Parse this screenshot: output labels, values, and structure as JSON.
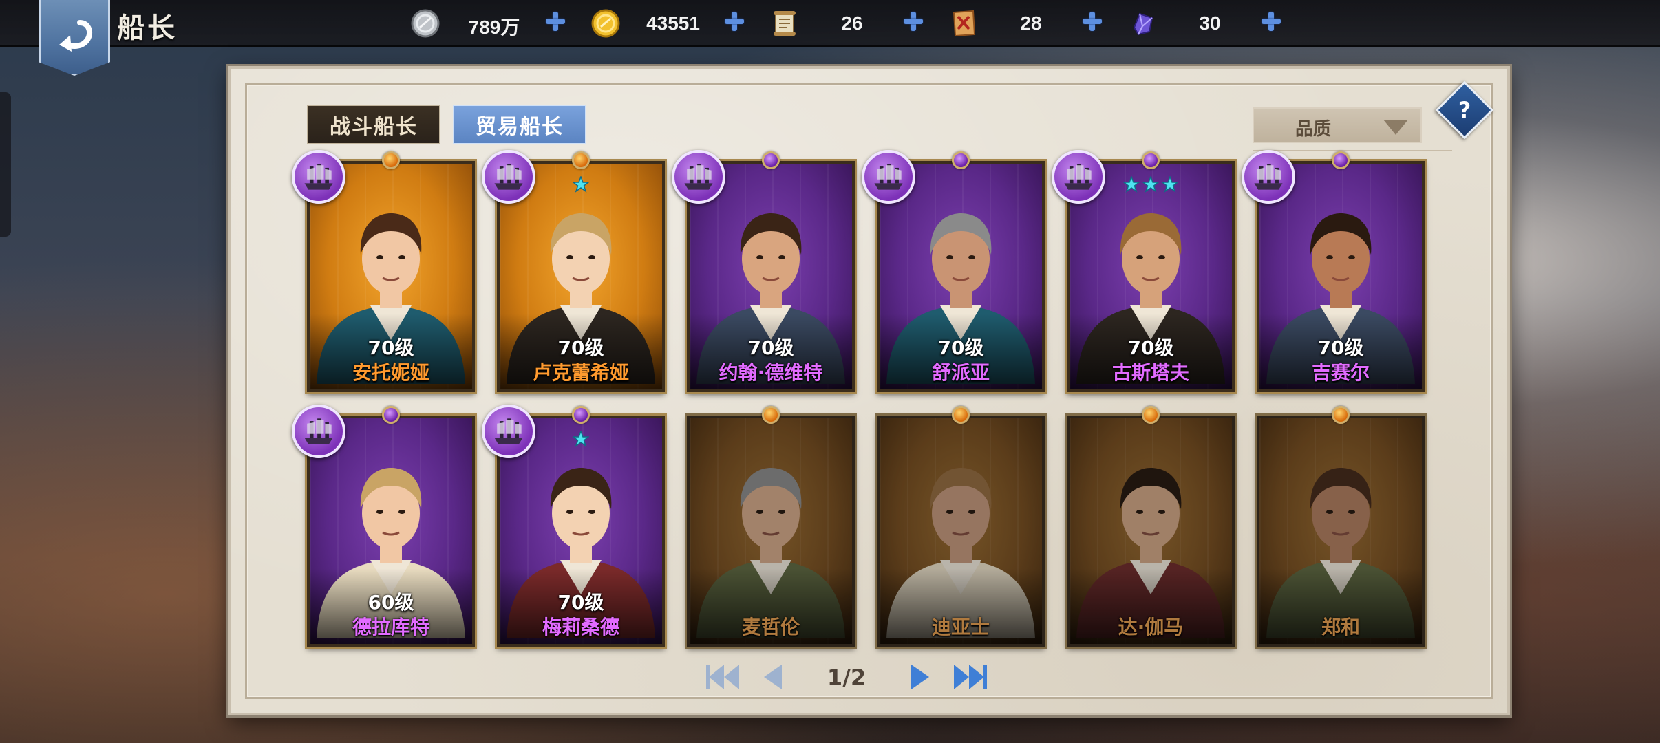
{
  "header": {
    "title": "船长",
    "back_icon": "back-arrow-icon",
    "currencies": [
      {
        "id": "silver",
        "icon": "silver-coin-icon",
        "value": "789万"
      },
      {
        "id": "gold",
        "icon": "gold-coin-icon",
        "value": "43551"
      },
      {
        "id": "scroll",
        "icon": "scroll-icon",
        "value": "26"
      },
      {
        "id": "map",
        "icon": "treasure-map-icon",
        "value": "28"
      },
      {
        "id": "crystal",
        "icon": "crystal-icon",
        "value": "30"
      }
    ]
  },
  "tabs": {
    "battle": "战斗船长",
    "trade": "贸易船长",
    "active": "trade"
  },
  "filter": {
    "label": "品质"
  },
  "help": {
    "label": "?"
  },
  "captains": [
    {
      "name": "安托妮娅",
      "level": "70级",
      "rarity": "orange",
      "owned": true,
      "stars": 0
    },
    {
      "name": "卢克蕾希娅",
      "level": "70级",
      "rarity": "orange",
      "owned": true,
      "stars": 1
    },
    {
      "name": "约翰·德维特",
      "level": "70级",
      "rarity": "purple",
      "owned": true,
      "stars": 0
    },
    {
      "name": "舒派亚",
      "level": "70级",
      "rarity": "purple",
      "owned": true,
      "stars": 0
    },
    {
      "name": "古斯塔夫",
      "level": "70级",
      "rarity": "purple",
      "owned": true,
      "stars": 3
    },
    {
      "name": "吉赛尔",
      "level": "70级",
      "rarity": "purple",
      "owned": true,
      "stars": 0
    },
    {
      "name": "德拉库特",
      "level": "60级",
      "rarity": "purple",
      "owned": true,
      "stars": 0
    },
    {
      "name": "梅莉桑德",
      "level": "70级",
      "rarity": "purple",
      "owned": true,
      "stars": 1
    },
    {
      "name": "麦哲伦",
      "level": "",
      "rarity": "orange",
      "owned": false,
      "stars": 0
    },
    {
      "name": "迪亚士",
      "level": "",
      "rarity": "orange",
      "owned": false,
      "stars": 0
    },
    {
      "name": "达·伽马",
      "level": "",
      "rarity": "orange",
      "owned": false,
      "stars": 0
    },
    {
      "name": "郑和",
      "level": "",
      "rarity": "orange",
      "owned": false,
      "stars": 0
    }
  ],
  "pagination": {
    "current": 1,
    "total": 2,
    "text": "1/2"
  },
  "colors": {
    "orange_card": "#d07c12",
    "purple_card": "#5a2888",
    "orange_name": "#ff9a2e",
    "purple_name": "#e26bff",
    "tab_active": "#6b93cf",
    "tab_inactive": "#2f2620",
    "plus": "#5d8fe0"
  }
}
